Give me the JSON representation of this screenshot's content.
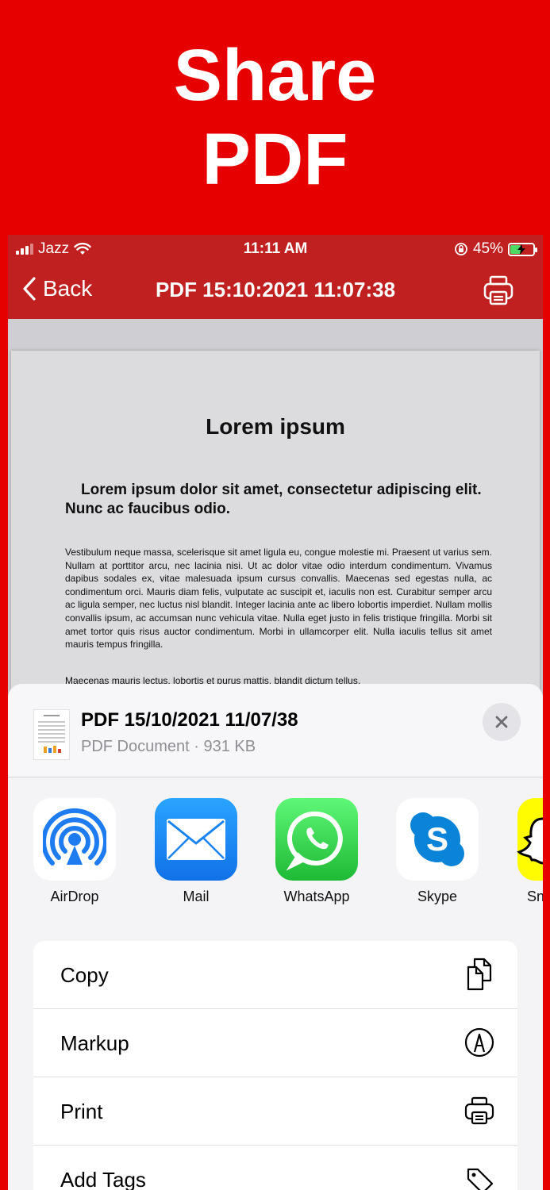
{
  "promo": {
    "title_line1": "Share",
    "title_line2": "PDF"
  },
  "status_bar": {
    "carrier": "Jazz",
    "time": "11:11 AM",
    "battery_percent": "45%",
    "battery_level": 0.45
  },
  "nav": {
    "back_label": "Back",
    "title": "PDF 15:10:2021 11:07:38",
    "print_icon": "printer-icon"
  },
  "document": {
    "heading": "Lorem ipsum",
    "subheading": "Lorem ipsum dolor sit amet, consectetur adipiscing elit. Nunc ac faucibus odio.",
    "paragraph1": "Vestibulum neque massa, scelerisque sit amet ligula eu, congue molestie mi. Praesent ut varius sem. Nullam at porttitor arcu, nec lacinia nisi. Ut ac dolor vitae odio interdum condimentum. Vivamus dapibus sodales ex, vitae malesuada ipsum cursus convallis. Maecenas sed egestas nulla, ac condimentum orci. Mauris diam felis, vulputate ac suscipit et, iaculis non est. Curabitur semper arcu ac ligula semper, nec luctus nisl blandit. Integer lacinia ante ac libero lobortis imperdiet. Nullam mollis convallis ipsum, ac accumsan nunc vehicula vitae. Nulla eget justo in felis tristique fringilla. Morbi sit amet tortor quis risus auctor condimentum. Morbi in ullamcorper elit. Nulla iaculis tellus sit amet mauris tempus fringilla.",
    "paragraph2": "Maecenas mauris lectus, lobortis et purus mattis, blandit dictum tellus."
  },
  "share_sheet": {
    "file_name": "PDF 15/10/2021 11/07/38",
    "file_meta": "PDF Document · 931 KB",
    "apps": [
      {
        "label": "AirDrop",
        "icon": "airdrop-icon"
      },
      {
        "label": "Mail",
        "icon": "mail-icon"
      },
      {
        "label": "WhatsApp",
        "icon": "whatsapp-icon"
      },
      {
        "label": "Skype",
        "icon": "skype-icon"
      },
      {
        "label": "Sn",
        "icon": "snapchat-icon"
      }
    ],
    "actions": [
      {
        "label": "Copy",
        "icon": "copy-icon"
      },
      {
        "label": "Markup",
        "icon": "markup-icon"
      },
      {
        "label": "Print",
        "icon": "printer-icon"
      },
      {
        "label": "Add Tags",
        "icon": "tag-icon"
      }
    ]
  },
  "colors": {
    "brand_red": "#e60000",
    "nav_red": "#c0201f",
    "mail_blue": "#1e8cf5",
    "whatsapp_green": "#25c03a",
    "skype_blue": "#0a84d8",
    "snap_yellow": "#fffc00"
  }
}
